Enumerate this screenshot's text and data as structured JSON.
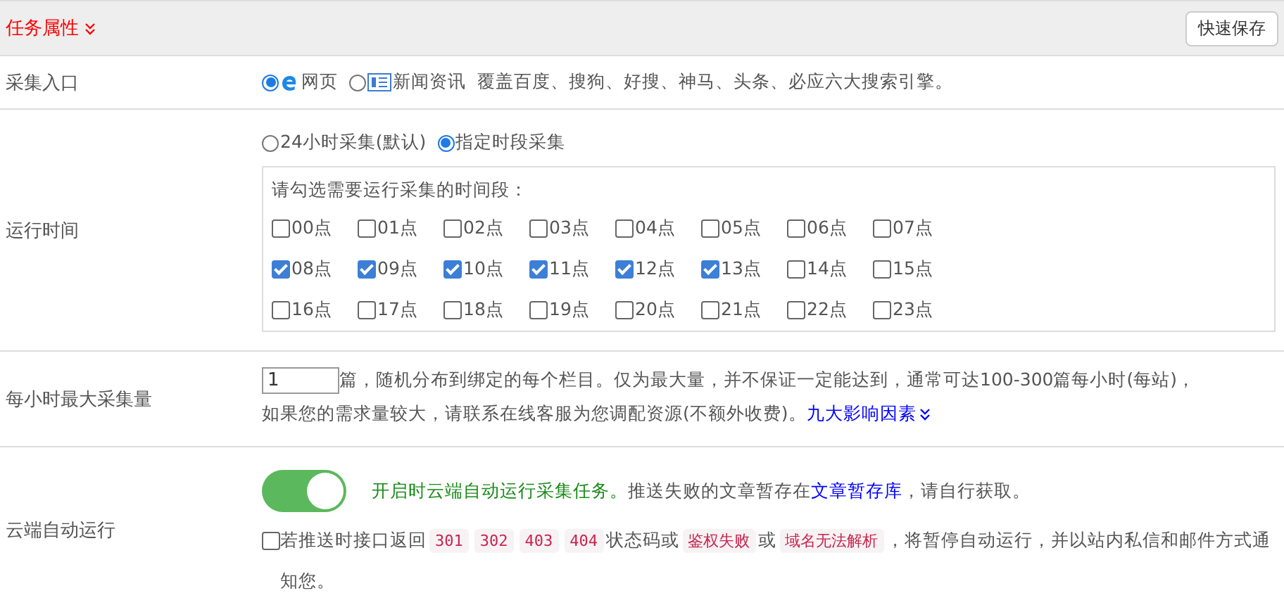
{
  "header": {
    "title": "任务属性",
    "save_button": "快速保存"
  },
  "entry": {
    "label": "采集入口",
    "options": [
      {
        "kind": "web",
        "label": "网页",
        "selected": true
      },
      {
        "kind": "news",
        "label": "新闻资讯",
        "selected": false
      }
    ],
    "note": "覆盖百度、搜狗、好搜、神马、头条、必应六大搜索引擎。"
  },
  "run_time": {
    "label": "运行时间",
    "modes": [
      {
        "label": "24小时采集(默认)",
        "selected": false
      },
      {
        "label": "指定时段采集",
        "selected": true
      }
    ],
    "hint": "请勾选需要运行采集的时间段：",
    "hours": [
      {
        "label": "00点",
        "checked": false
      },
      {
        "label": "01点",
        "checked": false
      },
      {
        "label": "02点",
        "checked": false
      },
      {
        "label": "03点",
        "checked": false
      },
      {
        "label": "04点",
        "checked": false
      },
      {
        "label": "05点",
        "checked": false
      },
      {
        "label": "06点",
        "checked": false
      },
      {
        "label": "07点",
        "checked": false
      },
      {
        "label": "08点",
        "checked": true
      },
      {
        "label": "09点",
        "checked": true
      },
      {
        "label": "10点",
        "checked": true
      },
      {
        "label": "11点",
        "checked": true
      },
      {
        "label": "12点",
        "checked": true
      },
      {
        "label": "13点",
        "checked": true
      },
      {
        "label": "14点",
        "checked": false
      },
      {
        "label": "15点",
        "checked": false
      },
      {
        "label": "16点",
        "checked": false
      },
      {
        "label": "17点",
        "checked": false
      },
      {
        "label": "18点",
        "checked": false
      },
      {
        "label": "19点",
        "checked": false
      },
      {
        "label": "20点",
        "checked": false
      },
      {
        "label": "21点",
        "checked": false
      },
      {
        "label": "22点",
        "checked": false
      },
      {
        "label": "23点",
        "checked": false
      }
    ]
  },
  "max_per_hour": {
    "label": "每小时最大采集量",
    "value": "1",
    "text": "篇，随机分布到绑定的每个栏目。仅为最大量，并不保证一定能达到，通常可达100-300篇每小时(每站)，",
    "text_line2": "如果您的需求量较大，请联系在线客服为您调配资源(不额外收费)。",
    "link": "九大影响因素"
  },
  "cloud": {
    "label": "云端自动运行",
    "toggle_on": true,
    "on_text": "开启时云端自动运行采集任务。",
    "note_before": "推送失败的文章暂存在",
    "link": "文章暂存库",
    "note_after": "，请自行获取。",
    "pause": {
      "checked": false,
      "parts": [
        {
          "kind": "plain",
          "text": "若推送时接口返回"
        },
        {
          "kind": "code",
          "text": "301"
        },
        {
          "kind": "code",
          "text": "302"
        },
        {
          "kind": "code",
          "text": "403"
        },
        {
          "kind": "code",
          "text": "404"
        },
        {
          "kind": "plain",
          "text": "状态码或"
        },
        {
          "kind": "code",
          "text": "鉴权失败"
        },
        {
          "kind": "plain",
          "text": "或"
        },
        {
          "kind": "code",
          "text": "域名无法解析"
        },
        {
          "kind": "plain",
          "text": "，将暂停自动运行，并以站内私信和邮件方式通知您。"
        }
      ]
    }
  }
}
